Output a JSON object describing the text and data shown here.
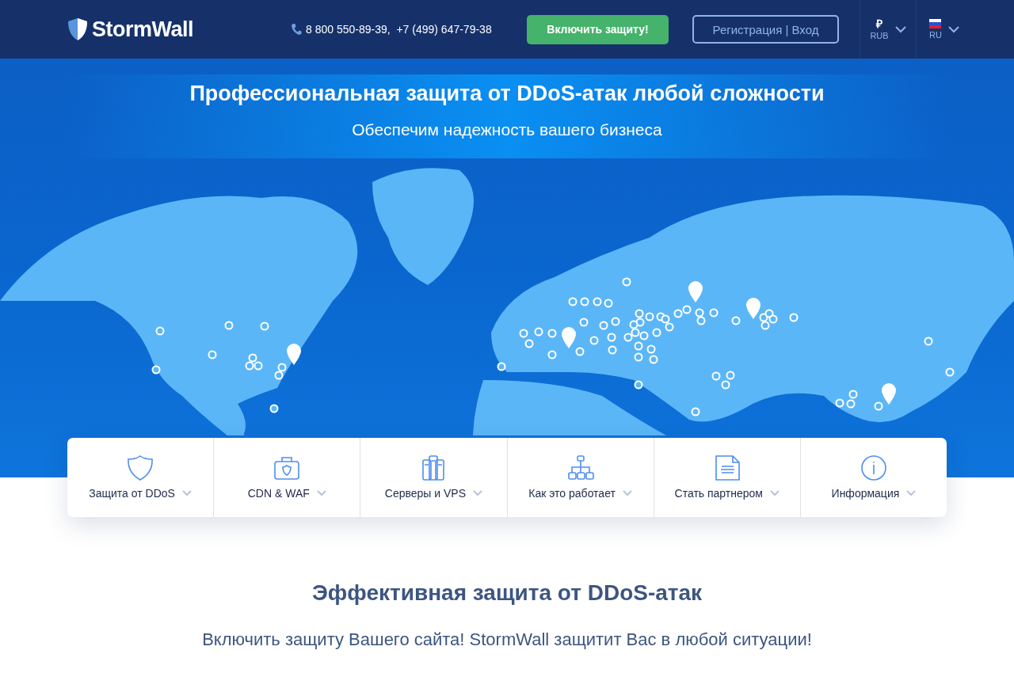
{
  "header": {
    "logo": "StormWall",
    "phones": "8 800 550-89-39,  +7 (499) 647-79-38",
    "cta_button": "Включить защиту!",
    "auth_button": "Регистрация | Вход",
    "currency": {
      "symbol": "₽",
      "code": "RUB"
    },
    "language": {
      "code": "RU"
    }
  },
  "hero": {
    "title": "Профессиональная защита от DDoS-атак любой сложности",
    "subtitle": "Обеспечим надежность вашего бизнеса"
  },
  "menu": [
    {
      "label": "Защита от DDoS",
      "kind": "shield"
    },
    {
      "label": "CDN & WAF",
      "kind": "case"
    },
    {
      "label": "Серверы и VPS",
      "kind": "servers"
    },
    {
      "label": "Как это работает",
      "kind": "network"
    },
    {
      "label": "Стать партнером",
      "kind": "document"
    },
    {
      "label": "Информация",
      "kind": "info"
    }
  ],
  "section": {
    "title": "Эффективная защита от DDoS-атак",
    "text": "Включить защиту Вашего сайта! StormWall защитит Вас в любой ситуации!"
  }
}
